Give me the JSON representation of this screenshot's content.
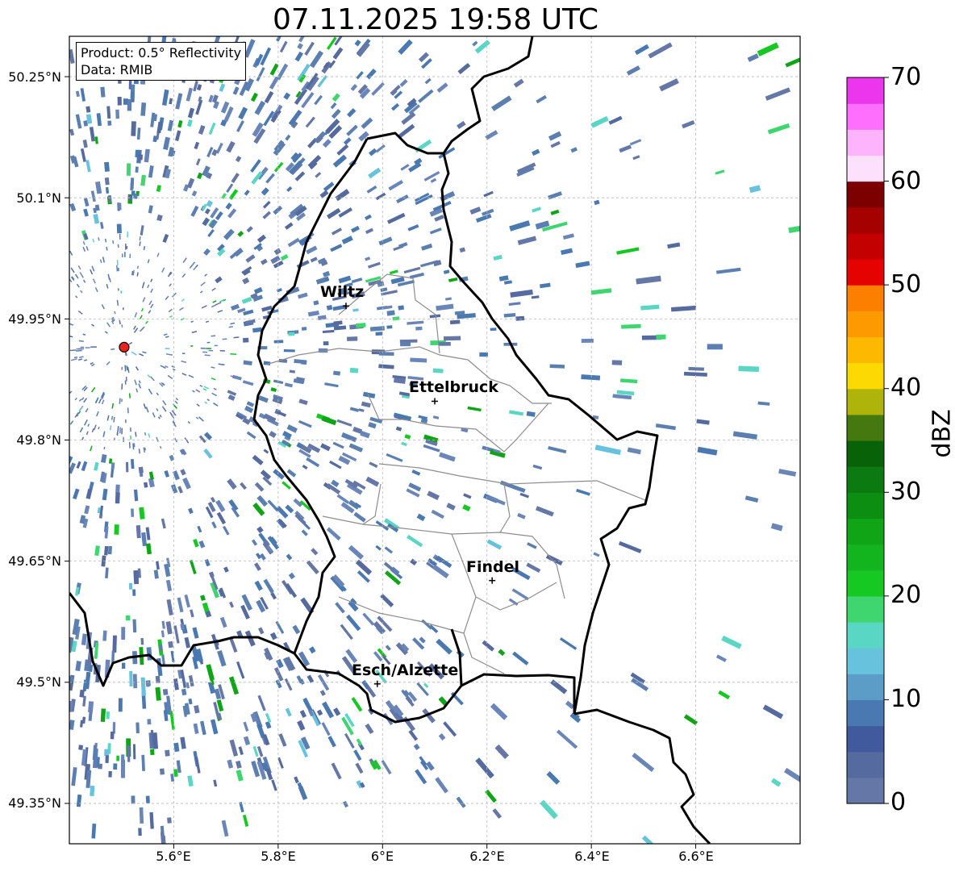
{
  "title": "07.11.2025 19:58 UTC",
  "info": {
    "product": "Product: 0.5° Reflectivity",
    "source": "Data: RMIB"
  },
  "map": {
    "lon_range": [
      5.4,
      6.8
    ],
    "lat_range": [
      49.3,
      50.3
    ],
    "y_ticks": [
      "50.25°N",
      "50.1°N",
      "49.95°N",
      "49.8°N",
      "49.65°N",
      "49.5°N",
      "49.35°N"
    ],
    "x_ticks": [
      "5.6°E",
      "5.8°E",
      "6°E",
      "6.2°E",
      "6.4°E",
      "6.6°E"
    ],
    "grid": true,
    "radar_site": {
      "lon": 5.505,
      "lat": 49.915,
      "color": "#e8251c"
    },
    "places": [
      {
        "name": "Wiltz",
        "lon": 5.93,
        "lat": 49.966
      },
      {
        "name": "Ettelbruck",
        "lon": 6.1,
        "lat": 49.848
      },
      {
        "name": "Findel",
        "lon": 6.21,
        "lat": 49.626
      },
      {
        "name": "Esch/Alzette",
        "lon": 5.99,
        "lat": 49.498
      }
    ]
  },
  "colorbar": {
    "unit": "dBZ",
    "ticks": [
      "0",
      "10",
      "20",
      "30",
      "40",
      "50",
      "60",
      "70"
    ],
    "range": [
      0,
      70
    ],
    "colors": [
      "#6577a6",
      "#556a9e",
      "#415a9e",
      "#4a78b0",
      "#5b9dc7",
      "#66c2dd",
      "#5ad6c4",
      "#3fd66f",
      "#16c822",
      "#12b51e",
      "#0fa516",
      "#0c8e12",
      "#0b7a10",
      "#086308",
      "#45780e",
      "#afb40a",
      "#fcd903",
      "#fdb802",
      "#fd9a01",
      "#fd7f00",
      "#e40301",
      "#c30101",
      "#a50101",
      "#7c0000",
      "#fde0fc",
      "#fdb4fc",
      "#fd6ffc",
      "#ec36ee"
    ]
  }
}
